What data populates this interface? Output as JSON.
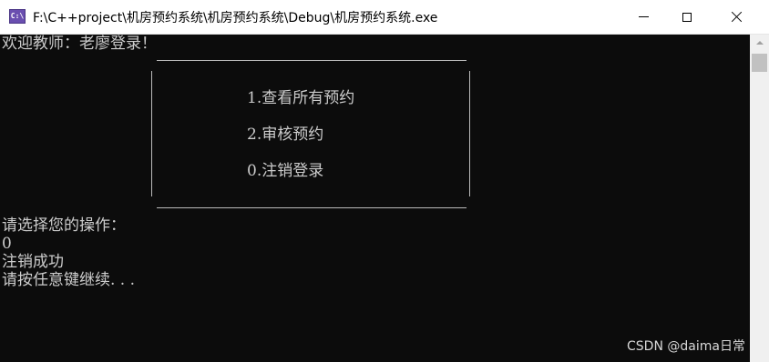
{
  "window": {
    "title": "F:\\C++project\\机房预约系统\\机房预约系统\\Debug\\机房预约系统.exe",
    "icon": "console-app-icon",
    "icon_text": "C:\\"
  },
  "console": {
    "welcome": "欢迎教师：老廖登录！",
    "menu_items": [
      "1.查看所有预约",
      "2.审核预约",
      "0.注销登录"
    ],
    "prompt": "请选择您的操作：",
    "input": "0",
    "result": "注销成功",
    "continue": "请按任意键继续. . ."
  },
  "watermark": "CSDN @daima日常",
  "colors": {
    "background": "#0c0c0c",
    "text": "#cccccc",
    "titlebar": "#ffffff",
    "scrollbar": "#f0f0f0"
  }
}
